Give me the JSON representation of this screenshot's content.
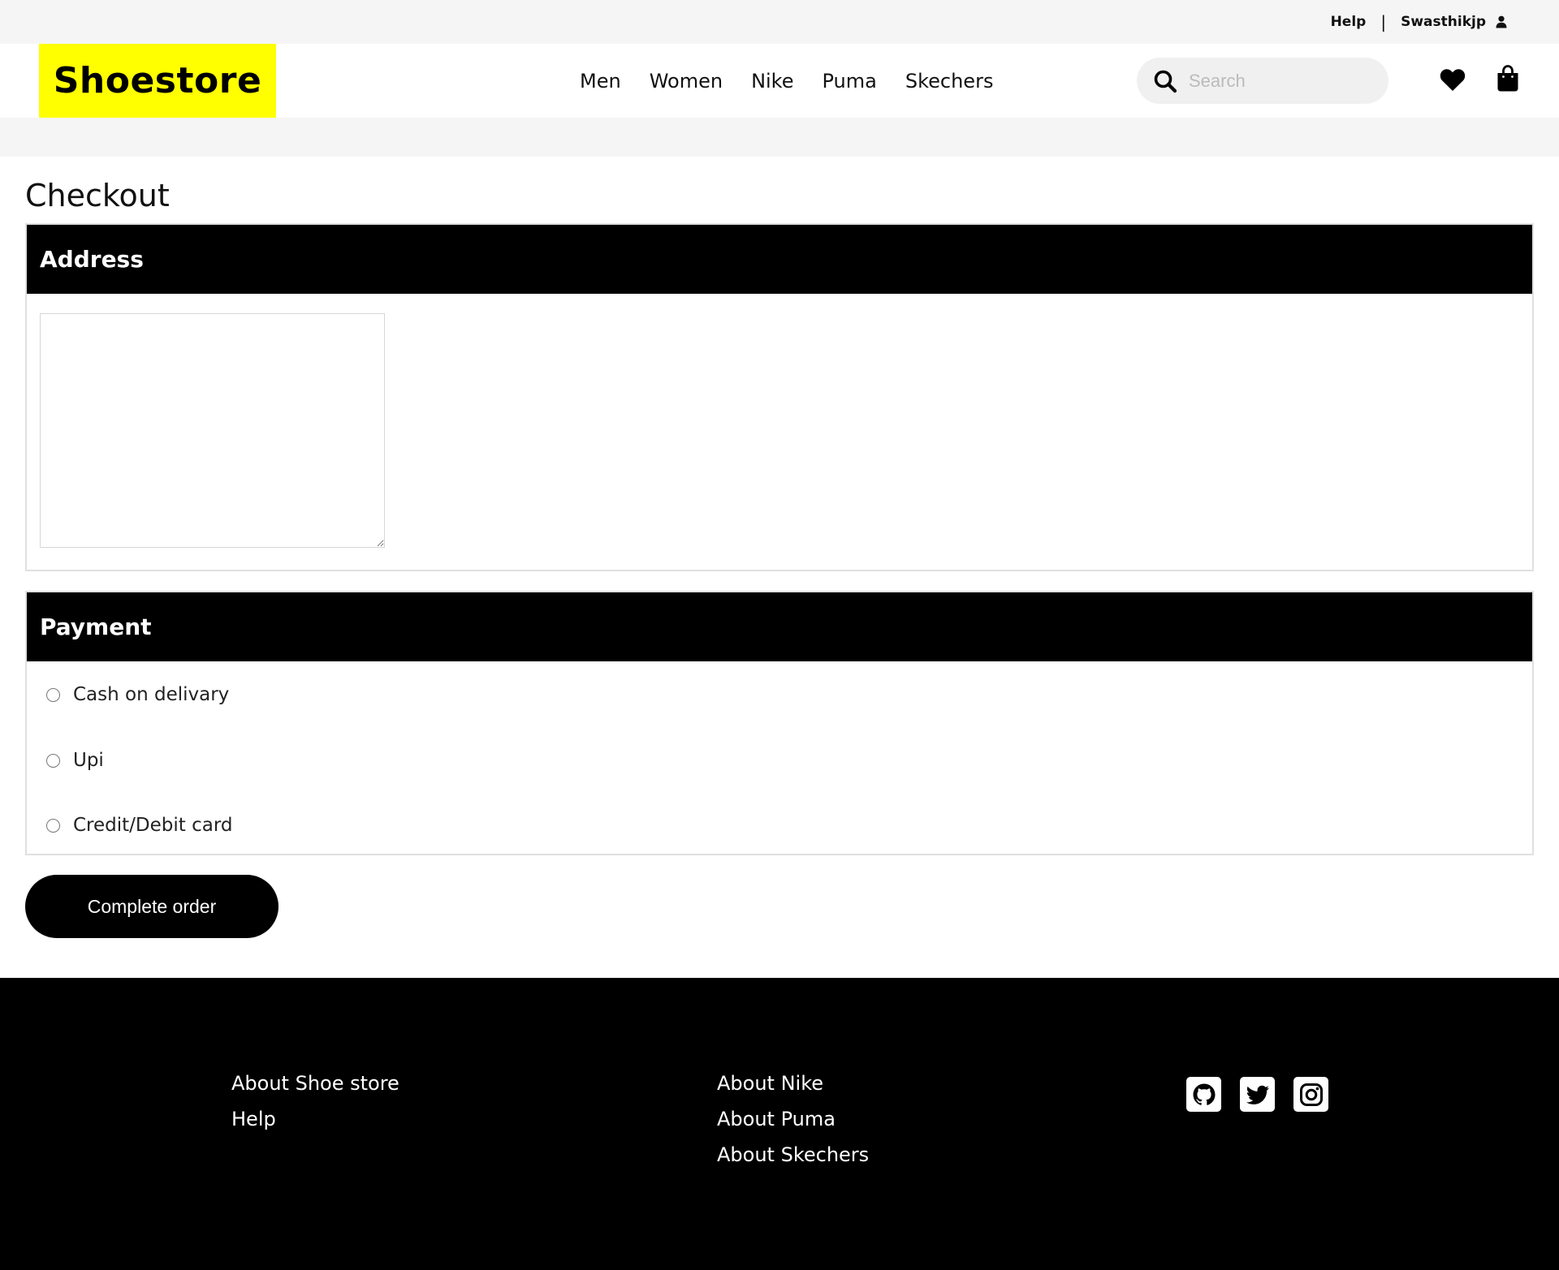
{
  "topbar": {
    "help_label": "Help",
    "separator": "|",
    "username": "Swasthikjp"
  },
  "header": {
    "logo": "Shoestore",
    "nav": [
      "Men",
      "Women",
      "Nike",
      "Puma",
      "Skechers"
    ],
    "search": {
      "placeholder": "Search",
      "value": ""
    },
    "icons": [
      "heart-icon",
      "shopping-bag-icon",
      "search-icon",
      "user-icon"
    ]
  },
  "checkout": {
    "title": "Checkout",
    "address": {
      "heading": "Address",
      "value": ""
    },
    "payment": {
      "heading": "Payment",
      "options": [
        "Cash on delivary",
        "Upi",
        "Credit/Debit card"
      ],
      "selected": null
    },
    "submit_label": "Complete order"
  },
  "footer": {
    "col1": [
      "About Shoe store",
      "Help"
    ],
    "col2": [
      "About Nike",
      "About Puma",
      "About Skechers"
    ],
    "social_icons": [
      "github-icon",
      "twitter-icon",
      "instagram-icon"
    ]
  },
  "colors": {
    "logo_bg": "#ffff00",
    "panel_head_bg": "#000000",
    "footer_bg": "#000000",
    "topbar_bg": "#f5f5f5"
  }
}
